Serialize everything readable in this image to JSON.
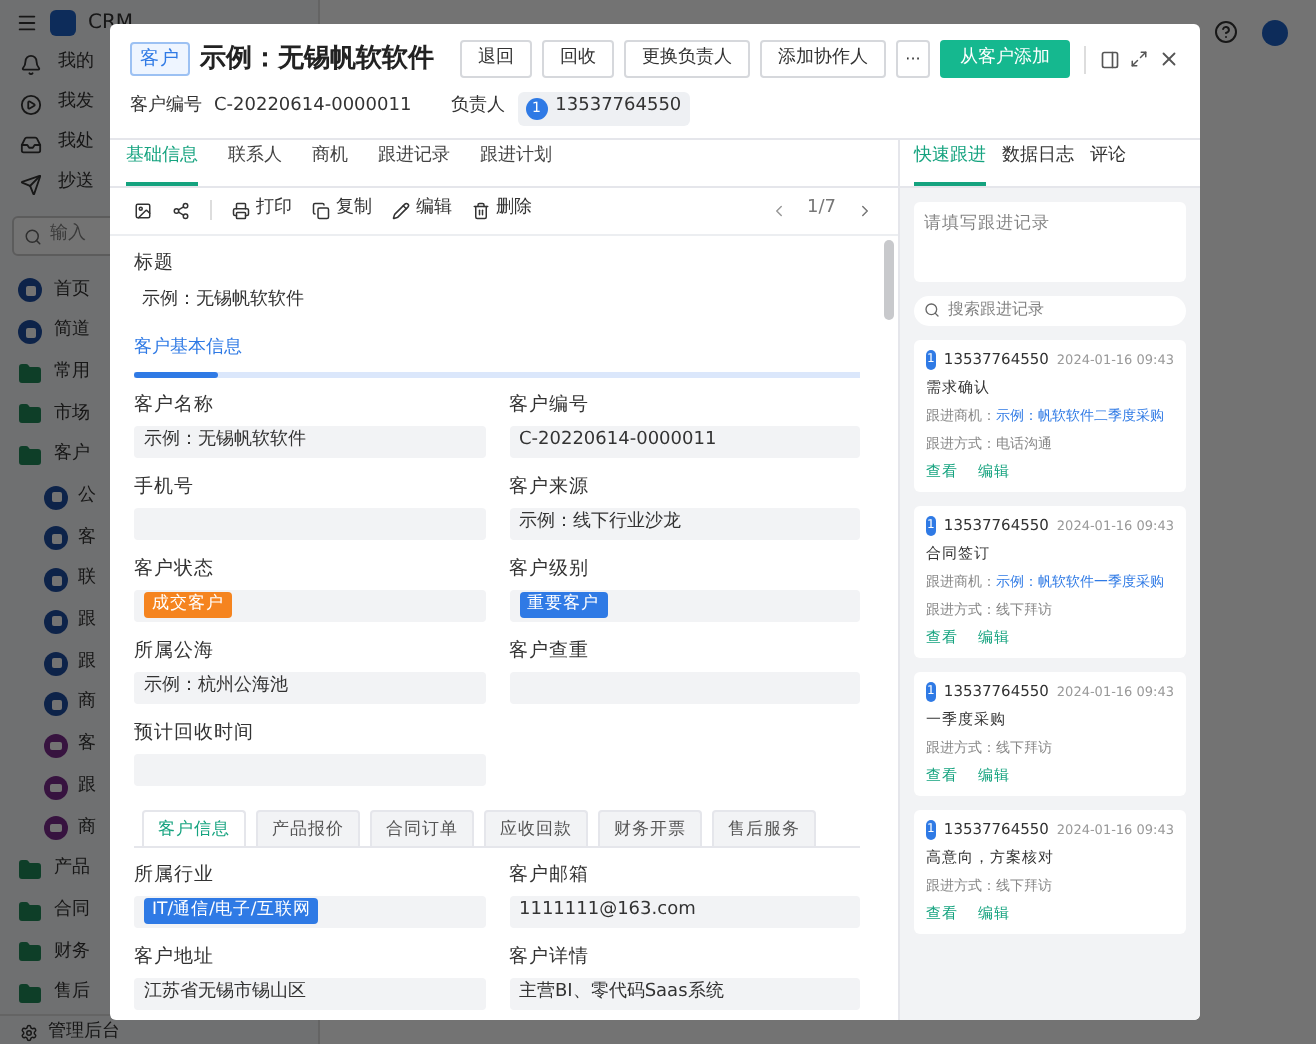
{
  "app": {
    "title": "CRM",
    "top_menu": [
      {
        "label": "我的"
      },
      {
        "label": "我发"
      },
      {
        "label": "我处"
      },
      {
        "label": "抄送"
      }
    ],
    "search": {
      "placeholder": "输入"
    },
    "nav": [
      {
        "label": "首页",
        "kind": "module"
      },
      {
        "label": "简道",
        "kind": "module"
      },
      {
        "label": "常用",
        "kind": "folder"
      },
      {
        "label": "市场",
        "kind": "folder"
      },
      {
        "label": "客户",
        "kind": "folder"
      },
      {
        "label": "公",
        "kind": "module"
      },
      {
        "label": "客",
        "kind": "module"
      },
      {
        "label": "联",
        "kind": "module"
      },
      {
        "label": "跟",
        "kind": "module"
      },
      {
        "label": "跟",
        "kind": "module"
      },
      {
        "label": "商",
        "kind": "module"
      },
      {
        "label": "客",
        "kind": "report"
      },
      {
        "label": "跟",
        "kind": "report"
      },
      {
        "label": "商",
        "kind": "report"
      },
      {
        "label": "产品",
        "kind": "folder"
      },
      {
        "label": "合同",
        "kind": "folder"
      },
      {
        "label": "财务",
        "kind": "folder"
      },
      {
        "label": "售后",
        "kind": "folder"
      }
    ],
    "footer": "管理后台"
  },
  "modal": {
    "tag": "客户",
    "title": "示例：无锡帆软软件",
    "buttons": [
      "退回",
      "回收",
      "更换负责人",
      "添加协作人"
    ],
    "more": "···",
    "primary_button": "从客户添加",
    "number_label": "客户编号",
    "number": "C-20220614-0000011",
    "owner_label": "负责人",
    "owner_avatar": "1",
    "owner": "13537764550",
    "tabs": [
      {
        "label": "基础信息",
        "selected": true
      },
      {
        "label": "联系人",
        "selected": false
      },
      {
        "label": "商机",
        "selected": false
      },
      {
        "label": "跟进记录",
        "selected": false
      },
      {
        "label": "跟进计划",
        "selected": false
      }
    ],
    "toolbar": [
      "打印",
      "复制",
      "编辑",
      "删除"
    ],
    "pager": "1/7",
    "title_field": {
      "label": "标题",
      "value": "示例：无锡帆软软件"
    },
    "section": "客户基本信息",
    "fields": [
      {
        "label": "客户名称",
        "value": "示例：无锡帆软软件",
        "kind": "text"
      },
      {
        "label": "客户编号",
        "value": "C-20220614-0000011",
        "kind": "text"
      },
      {
        "label": "手机号",
        "kind": "text"
      },
      {
        "label": "客户来源",
        "value": "示例：线下行业沙龙",
        "kind": "text"
      },
      {
        "label": "客户状态",
        "value": "成交客户",
        "kind": "tag",
        "color": "#f5841f"
      },
      {
        "label": "客户级别",
        "value": "重要客户",
        "kind": "tag",
        "color": "#2f7ae5"
      },
      {
        "label": "所属公海",
        "value": "示例：杭州公海池",
        "kind": "text"
      },
      {
        "label": "客户查重",
        "kind": "text"
      },
      {
        "label": "预计回收时间",
        "kind": "text"
      }
    ],
    "subtabs": [
      {
        "label": "客户信息",
        "selected": true
      },
      {
        "label": "产品报价",
        "selected": false
      },
      {
        "label": "合同订单",
        "selected": false
      },
      {
        "label": "应收回款",
        "selected": false
      },
      {
        "label": "财务开票",
        "selected": false
      },
      {
        "label": "售后服务",
        "selected": false
      }
    ],
    "subfields": [
      {
        "label": "所属行业",
        "value": "IT/通信/电子/互联网",
        "kind": "tag",
        "color": "#2f7ae5"
      },
      {
        "label": "客户邮箱",
        "value": "1111111@163.com",
        "kind": "text"
      },
      {
        "label": "客户地址",
        "value": "江苏省无锡市锡山区",
        "kind": "text"
      },
      {
        "label": "客户详情",
        "value": "主营BI、零代码Saas系统",
        "kind": "text"
      }
    ],
    "side_tabs": [
      {
        "label": "快速跟进",
        "selected": true
      },
      {
        "label": "数据日志",
        "selected": false
      },
      {
        "label": "评论",
        "selected": false
      }
    ],
    "note_placeholder": "请填写跟进记录",
    "search_placeholder": "搜索跟进记录",
    "records": [
      {
        "avatar": "1",
        "user": "13537764550",
        "time": "2024-01-16 09:43",
        "title": "需求确认",
        "deal_label": "跟进商机：",
        "deal": "示例：帆软软件二季度采购",
        "method": "跟进方式：电话沟通",
        "actions": [
          "查看",
          "编辑"
        ]
      },
      {
        "avatar": "1",
        "user": "13537764550",
        "time": "2024-01-16 09:43",
        "title": "合同签订",
        "deal_label": "跟进商机：",
        "deal": "示例：帆软软件一季度采购",
        "method": "跟进方式：线下拜访",
        "actions": [
          "查看",
          "编辑"
        ]
      },
      {
        "avatar": "1",
        "user": "13537764550",
        "time": "2024-01-16 09:43",
        "title": "一季度采购",
        "method": "跟进方式：线下拜访",
        "actions": [
          "查看",
          "编辑"
        ]
      },
      {
        "avatar": "1",
        "user": "13537764550",
        "time": "2024-01-16 09:43",
        "title": "高意向，方案核对",
        "method": "跟进方式：线下拜访",
        "actions": [
          "查看",
          "编辑"
        ]
      }
    ]
  }
}
